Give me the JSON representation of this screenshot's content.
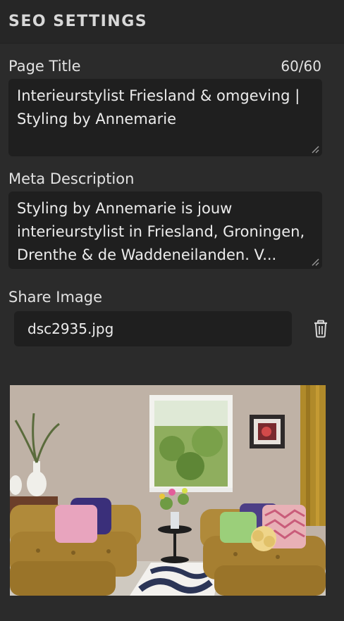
{
  "panel": {
    "title": "SEO SETTINGS"
  },
  "page_title": {
    "label": "Page Title",
    "counter": "60/60",
    "value": "Interieurstylist Friesland & omgeving | Styling by Annemarie"
  },
  "meta_description": {
    "label": "Meta Description",
    "value": "Styling by Annemarie is jouw interieurstylist in Friesland, Groningen, Drenthe & de Waddeneilanden. V..."
  },
  "share_image": {
    "label": "Share Image",
    "filename": "dsc2935.jpg",
    "delete_icon": "trash-icon"
  },
  "colors": {
    "background": "#2b2b2b",
    "field": "#1f1f1f",
    "text": "#ececec"
  }
}
